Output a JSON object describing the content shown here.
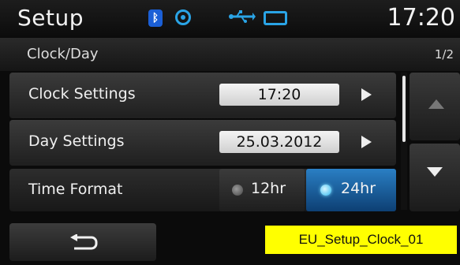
{
  "statusbar": {
    "title": "Setup",
    "time": "17:20",
    "icons": [
      "bluetooth-icon",
      "disc-icon",
      "usb-icon",
      "mirror-link-icon"
    ],
    "accent": "#2aa4e6"
  },
  "subheader": {
    "title": "Clock/Day",
    "page": "1/2"
  },
  "rows": {
    "clock": {
      "label": "Clock Settings",
      "value": "17:20"
    },
    "day": {
      "label": "Day Settings",
      "value": "25.03.2012"
    },
    "format": {
      "label": "Time Format",
      "option_12": "12hr",
      "option_24": "24hr",
      "selected": "24hr"
    }
  },
  "annotation": {
    "label": "EU_Setup_Clock_01",
    "color": "#ffff00"
  }
}
